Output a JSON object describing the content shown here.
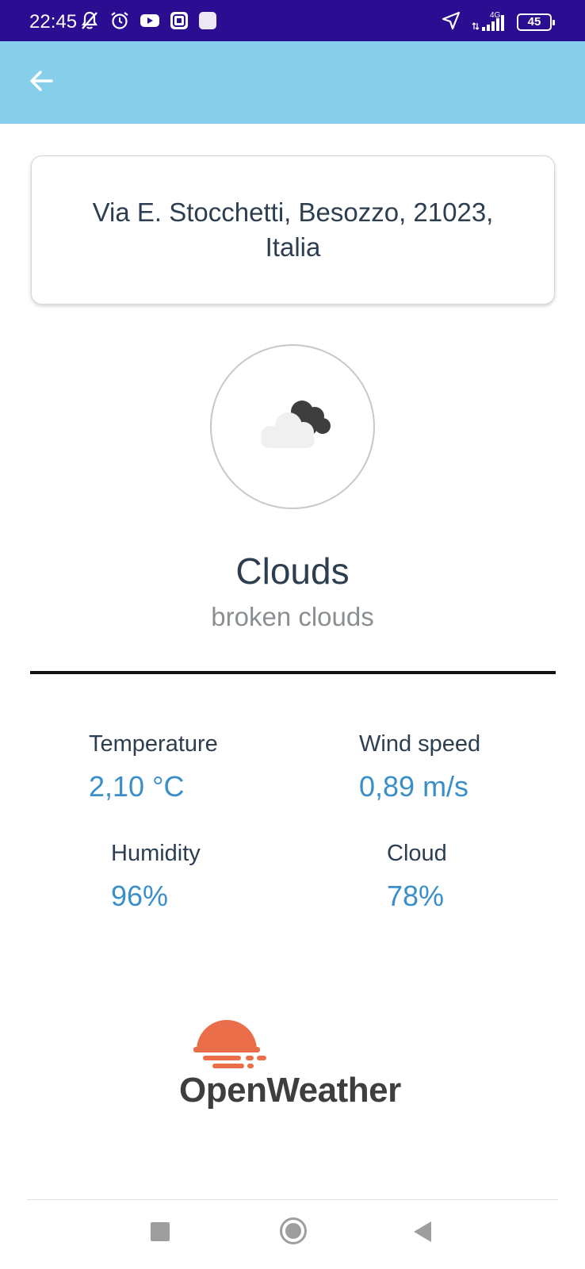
{
  "status_bar": {
    "time": "22:45",
    "network_label": "4G",
    "battery_level": "45",
    "icons_left": [
      "mute-icon",
      "alarm-icon",
      "youtube-icon",
      "app-icon",
      "app-icon"
    ],
    "icons_right": [
      "location-icon",
      "signal-icon",
      "battery-icon"
    ]
  },
  "app_bar": {
    "background": "#87ceea",
    "back_icon": "arrow-left-icon"
  },
  "location": {
    "address": "Via E. Stocchetti, Besozzo, 21023, Italia"
  },
  "weather": {
    "icon": "broken-clouds-icon",
    "main": "Clouds",
    "description": "broken clouds"
  },
  "stats": {
    "temperature": {
      "label": "Temperature",
      "value": "2,10 °C"
    },
    "wind_speed": {
      "label": "Wind speed",
      "value": "0,89 m/s"
    },
    "humidity": {
      "label": "Humidity",
      "value": "96%"
    },
    "cloud": {
      "label": "Cloud",
      "value": "78%"
    }
  },
  "branding": {
    "logo_text": "OpenWeather",
    "logo_color": "#eb6e4b"
  },
  "nav_bar": {
    "buttons": [
      "recents-button",
      "home-button",
      "back-button"
    ]
  },
  "colors": {
    "status_bar": "#2a0d91",
    "text_dark": "#2c3e50",
    "text_muted": "#8a8f94",
    "value_blue": "#3a8fc8"
  }
}
